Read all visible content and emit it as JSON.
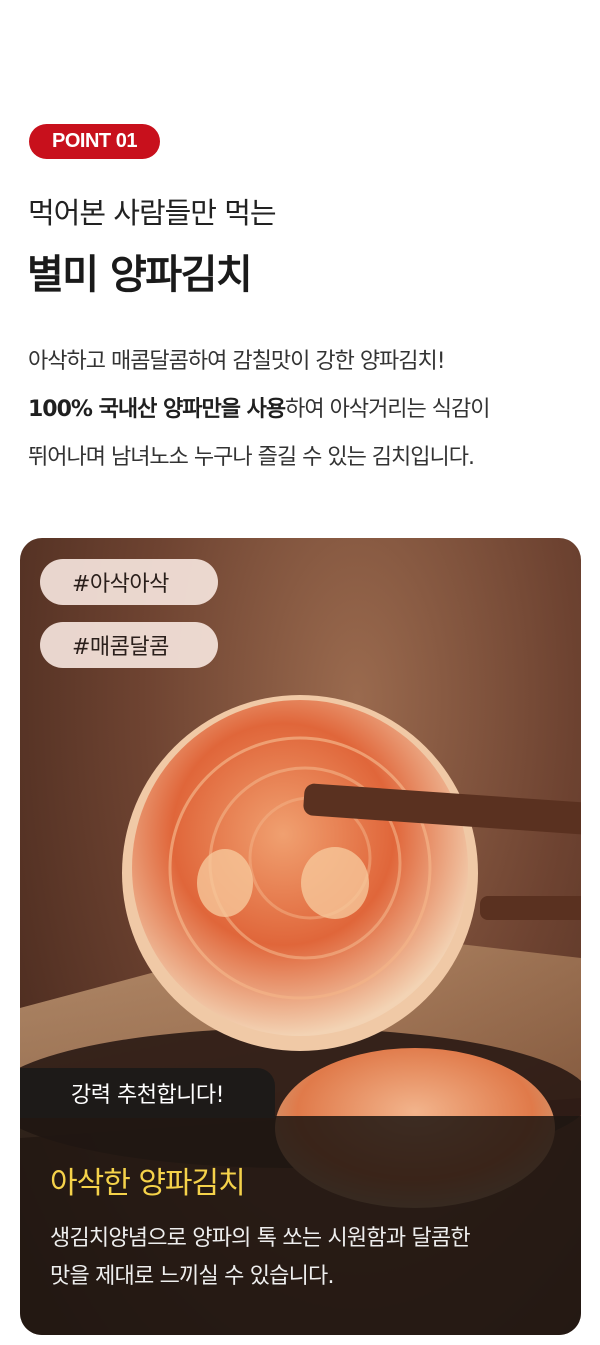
{
  "badge": "POINT 01",
  "subtitle": "먹어본 사람들만 먹는",
  "title": "별미 양파김치",
  "description": {
    "line1": "아삭하고 매콤달콤하여 감칠맛이 강한 양파김치!",
    "line2_bold": "100% 국내산 양파만을 사용",
    "line2_rest": "하여 아삭거리는 식감이",
    "line3": "뛰어나며 남녀노소 누구나 즐길 수 있는 김치입니다."
  },
  "tags": [
    "#아삭아삭",
    "#매콤달콤"
  ],
  "recommend_label": "강력 추천합니다!",
  "feature": {
    "title": "아삭한 양파김치",
    "desc_line1": "생김치양념으로 양파의 톡 쏘는 시원함과 달콤한",
    "desc_line2": "맛을 제대로 느끼실 수 있습니다."
  },
  "colors": {
    "badge": "#c8101c",
    "feature_title": "#f5d24a"
  }
}
